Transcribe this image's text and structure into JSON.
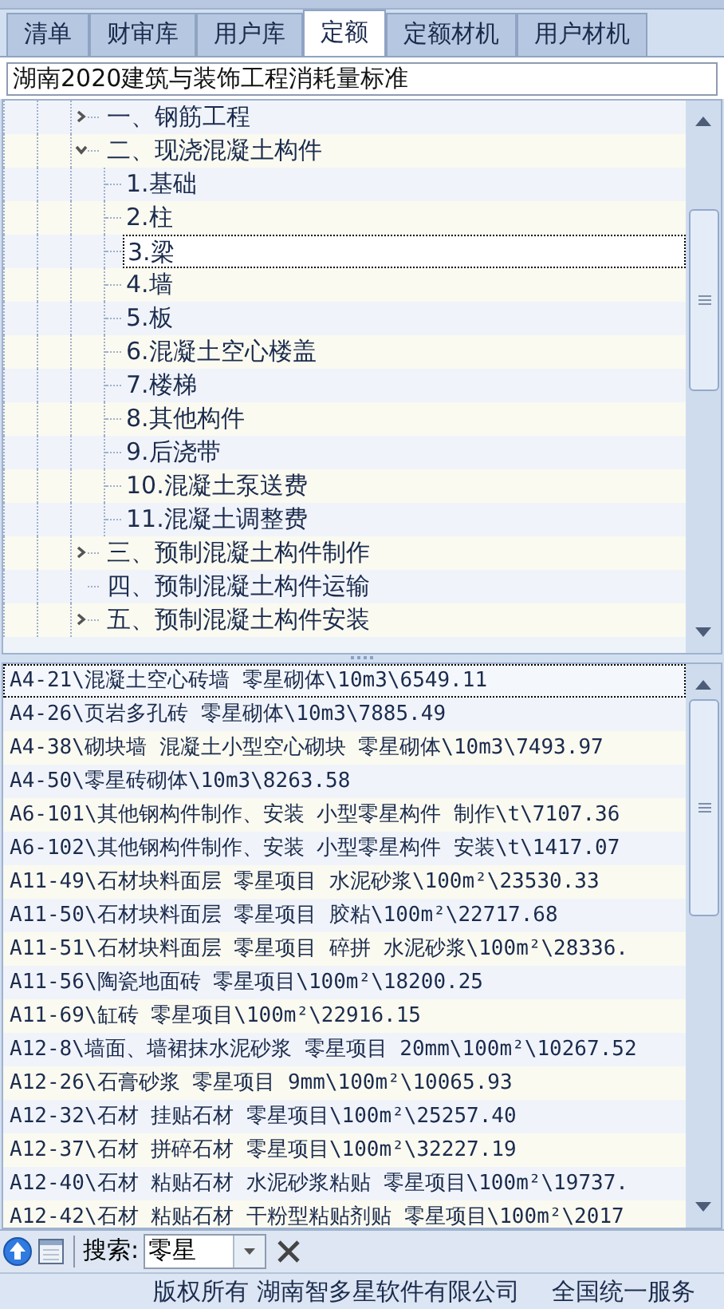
{
  "tabs": [
    {
      "label": "清单",
      "selected": false
    },
    {
      "label": "财审库",
      "selected": false
    },
    {
      "label": "用户库",
      "selected": false
    },
    {
      "label": "定额",
      "selected": true
    },
    {
      "label": "定额材机",
      "selected": false
    },
    {
      "label": "用户材机",
      "selected": false
    }
  ],
  "library": {
    "value": "湖南2020建筑与装饰工程消耗量标准"
  },
  "tree": {
    "items": [
      {
        "label": "一、钢筋工程",
        "expanded": false,
        "selected": false
      },
      {
        "label": "二、现浇混凝土构件",
        "expanded": true,
        "selected": false,
        "children": [
          {
            "label": "1.基础",
            "selected": false
          },
          {
            "label": "2.柱",
            "selected": false
          },
          {
            "label": "3.梁",
            "selected": true
          },
          {
            "label": "4.墙",
            "selected": false
          },
          {
            "label": "5.板",
            "selected": false
          },
          {
            "label": "6.混凝土空心楼盖",
            "selected": false
          },
          {
            "label": "7.楼梯",
            "selected": false
          },
          {
            "label": "8.其他构件",
            "selected": false
          },
          {
            "label": "9.后浇带",
            "selected": false
          },
          {
            "label": "10.混凝土泵送费",
            "selected": false
          },
          {
            "label": "11.混凝土调整费",
            "selected": false
          }
        ]
      },
      {
        "label": "三、预制混凝土构件制作",
        "expanded": false,
        "selected": false
      },
      {
        "label": "四、预制混凝土构件运输",
        "selected": false
      },
      {
        "label": "五、预制混凝土构件安装",
        "expanded": false,
        "selected": false
      }
    ]
  },
  "results": [
    {
      "text": "A4-21\\混凝土空心砖墙 零星砌体\\10m3\\6549.11",
      "selected": true
    },
    {
      "text": "A4-26\\页岩多孔砖 零星砌体\\10m3\\7885.49",
      "selected": false
    },
    {
      "text": "A4-38\\砌块墙 混凝土小型空心砌块 零星砌体\\10m3\\7493.97",
      "selected": false
    },
    {
      "text": "A4-50\\零星砖砌体\\10m3\\8263.58",
      "selected": false
    },
    {
      "text": "A6-101\\其他钢构件制作、安装 小型零星构件 制作\\t\\7107.36",
      "selected": false
    },
    {
      "text": "A6-102\\其他钢构件制作、安装 小型零星构件 安装\\t\\1417.07",
      "selected": false
    },
    {
      "text": "A11-49\\石材块料面层 零星项目 水泥砂浆\\100m²\\23530.33",
      "selected": false
    },
    {
      "text": "A11-50\\石材块料面层 零星项目 胶粘\\100m²\\22717.68",
      "selected": false
    },
    {
      "text": "A11-51\\石材块料面层 零星项目 碎拼 水泥砂浆\\100m²\\28336.",
      "selected": false
    },
    {
      "text": "A11-56\\陶瓷地面砖 零星项目\\100m²\\18200.25",
      "selected": false
    },
    {
      "text": "A11-69\\缸砖 零星项目\\100m²\\22916.15",
      "selected": false
    },
    {
      "text": "A12-8\\墙面、墙裙抹水泥砂浆 零星项目 20mm\\100m²\\10267.52",
      "selected": false
    },
    {
      "text": "A12-26\\石膏砂浆 零星项目 9mm\\100m²\\10065.93",
      "selected": false
    },
    {
      "text": "A12-32\\石材 挂贴石材 零星项目\\100m²\\25257.40",
      "selected": false
    },
    {
      "text": "A12-37\\石材 拼碎石材 零星项目\\100m²\\32227.19",
      "selected": false
    },
    {
      "text": "A12-40\\石材 粘贴石材 水泥砂浆粘贴 零星项目\\100m²\\19737.",
      "selected": false
    },
    {
      "text": "A12-42\\石材 粘贴石材 干粉型粘贴剂贴 零星项目\\100m²\\2017",
      "selected": false
    }
  ],
  "search": {
    "label": "搜索:",
    "value": "零星"
  },
  "status_bar": {
    "copyright": "版权所有 湖南智多星软件有限公司",
    "service": "全国统一服务"
  }
}
